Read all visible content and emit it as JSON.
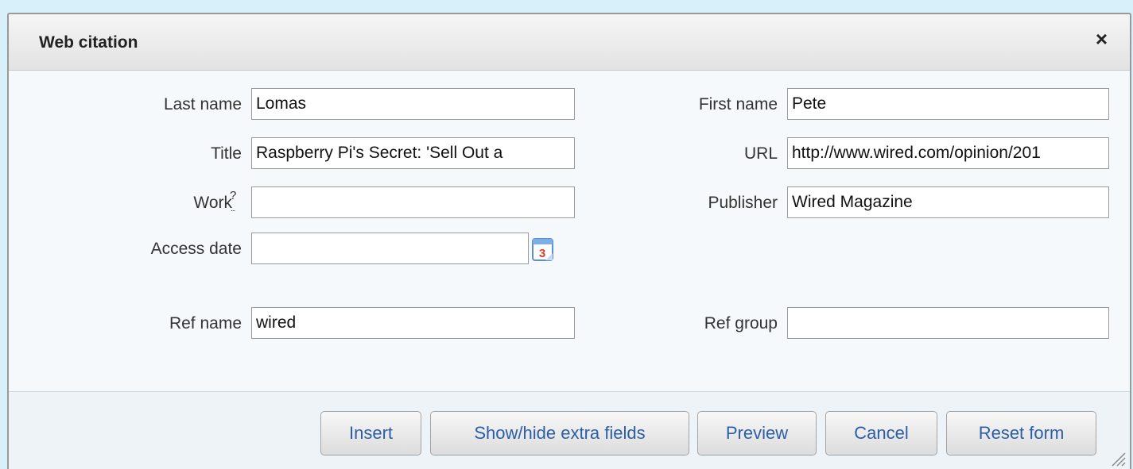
{
  "dialog": {
    "title": "Web citation",
    "close_label": "×"
  },
  "fields": {
    "last_name": {
      "label": "Last name",
      "value": "Lomas"
    },
    "first_name": {
      "label": "First name",
      "value": "Pete"
    },
    "title": {
      "label": "Title",
      "value": "Raspberry Pi's Secret: 'Sell Out a"
    },
    "url": {
      "label": "URL",
      "value": "http://www.wired.com/opinion/201"
    },
    "work": {
      "label": "Work",
      "help": "?",
      "help_dots": "...",
      "value": ""
    },
    "publisher": {
      "label": "Publisher",
      "value": "Wired Magazine"
    },
    "access_date": {
      "label": "Access date",
      "value": "",
      "calendar_icon": "calendar-icon",
      "calendar_day": "3"
    },
    "ref_name": {
      "label": "Ref name",
      "value": "wired"
    },
    "ref_group": {
      "label": "Ref group",
      "value": ""
    }
  },
  "buttons": {
    "insert": "Insert",
    "extra": "Show/hide extra fields",
    "preview": "Preview",
    "cancel": "Cancel",
    "reset": "Reset form"
  }
}
